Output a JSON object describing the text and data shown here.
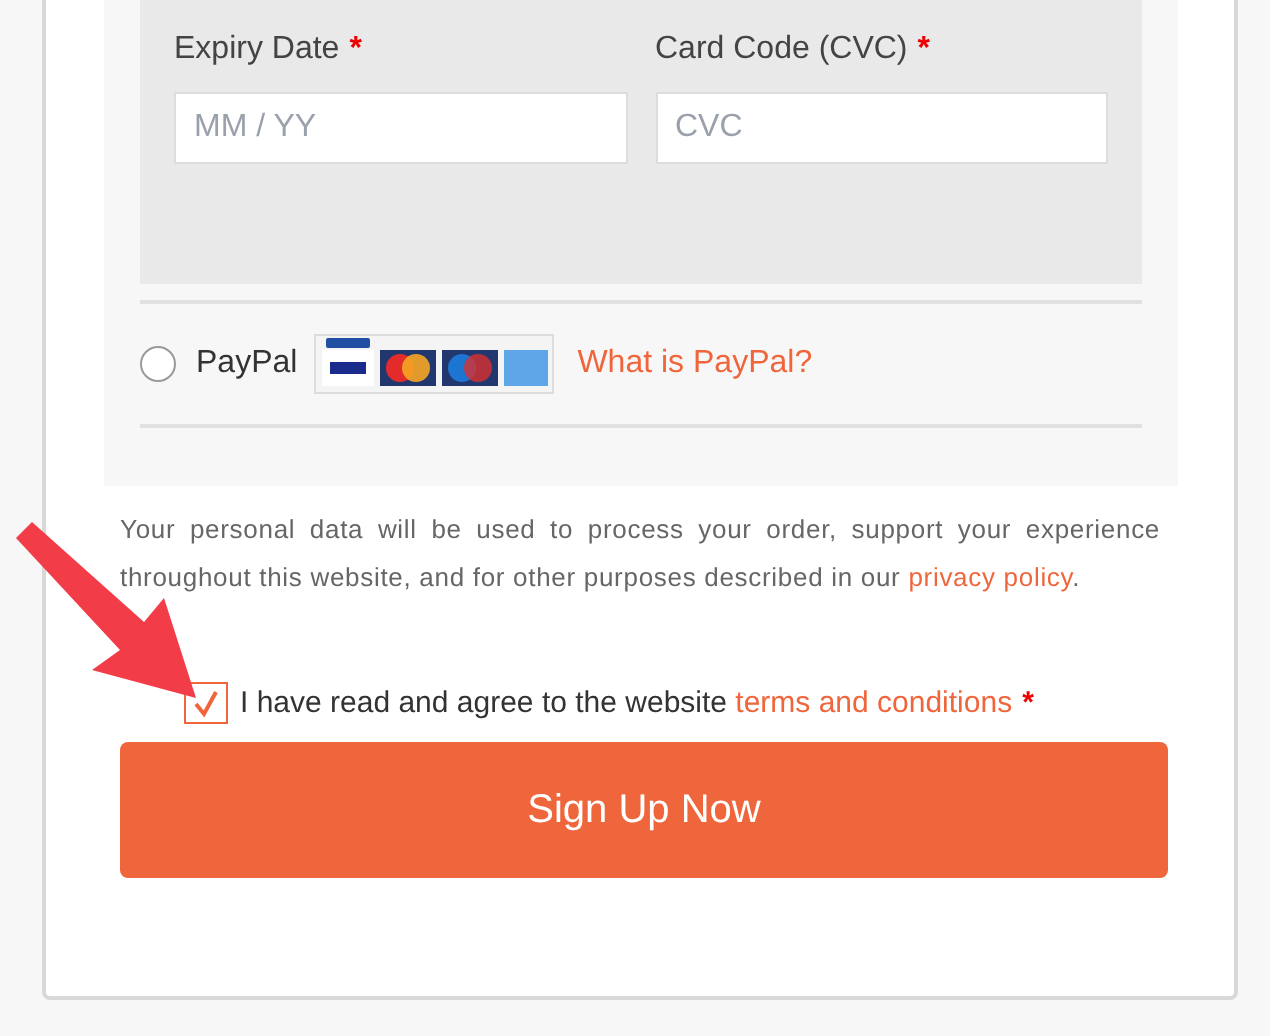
{
  "card_fields": [
    {
      "label": "Expiry Date",
      "required_mark": "*",
      "placeholder": "MM / YY"
    },
    {
      "label": "Card Code (CVC)",
      "required_mark": "*",
      "placeholder": "CVC"
    }
  ],
  "paypal": {
    "label": "PayPal",
    "selected": false,
    "link": "What is PayPal?"
  },
  "privacy": {
    "text": "Your personal data will be used to process your order, support your experience throughout this website, and for other purposes described in our",
    "link": "privacy policy",
    "end": "."
  },
  "terms": {
    "checked": true,
    "text": "I have read and agree to the website",
    "link": "terms and conditions",
    "required_mark": "*"
  },
  "submit": {
    "label": "Sign Up Now"
  }
}
